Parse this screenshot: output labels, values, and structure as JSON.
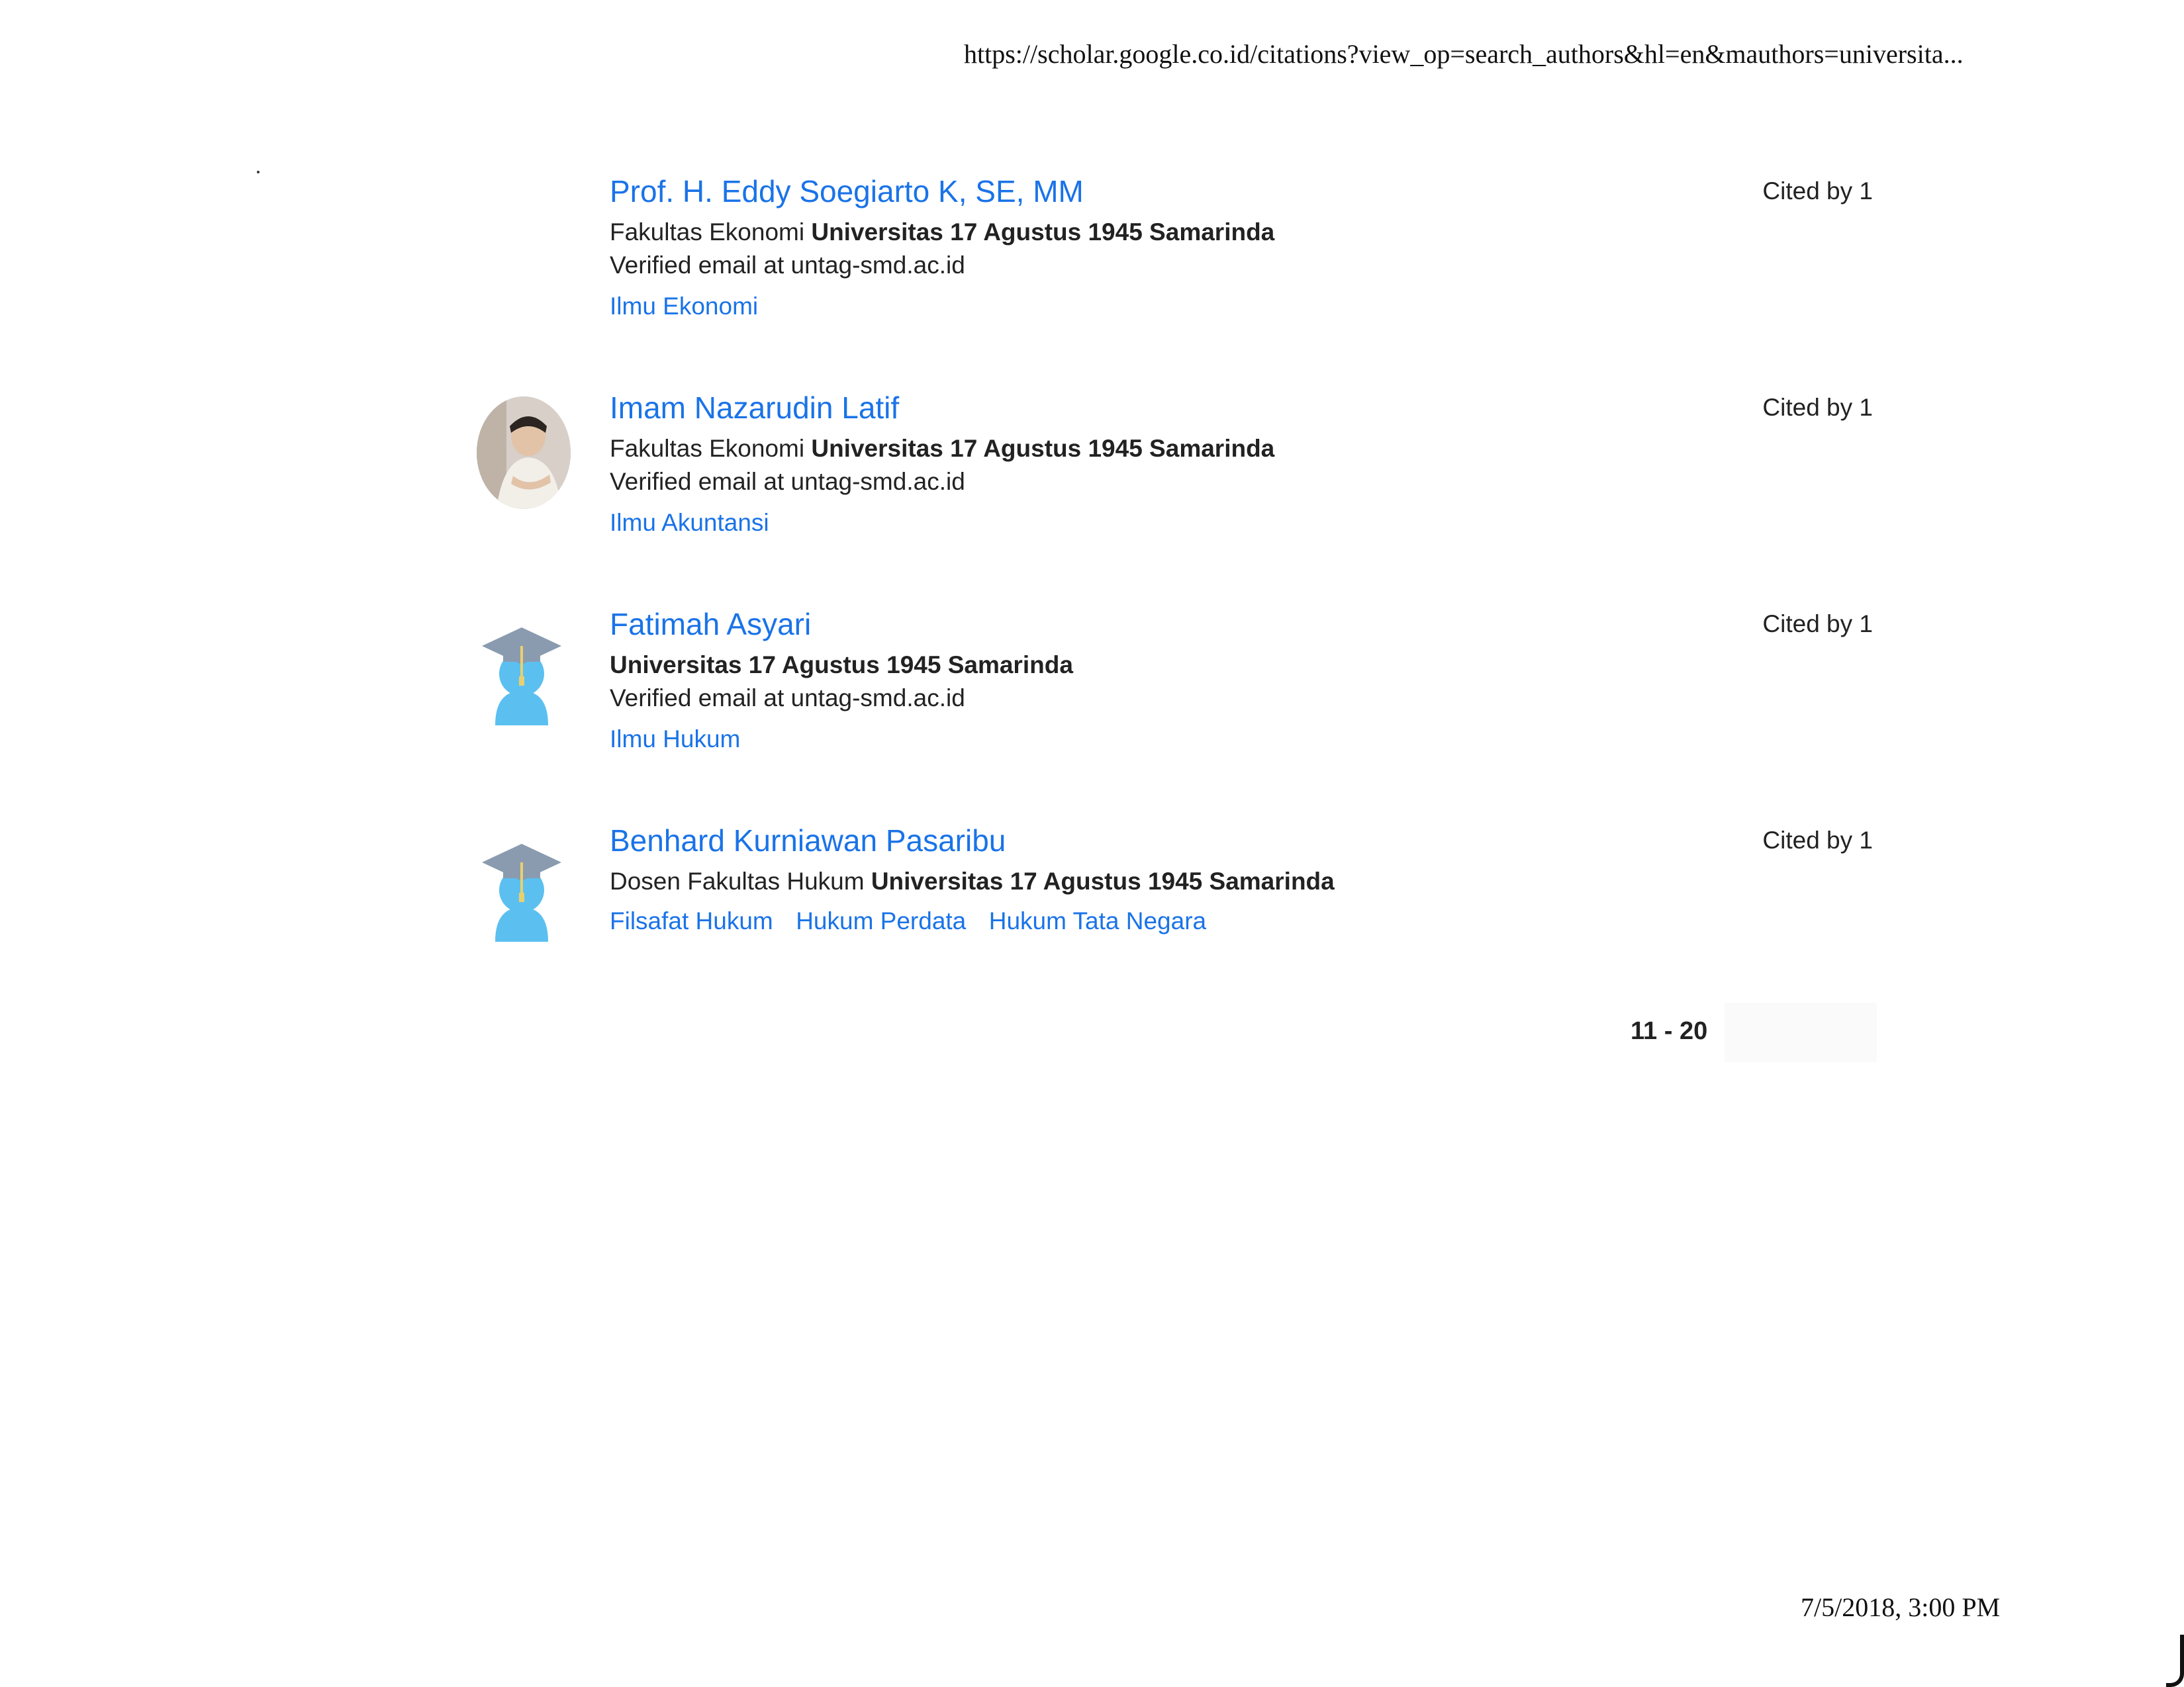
{
  "print": {
    "url": "https://scholar.google.co.id/citations?view_op=search_authors&hl=en&mauthors=universita...",
    "datetime": "7/5/2018, 3:00 PM"
  },
  "authors": [
    {
      "name": "Prof. H. Eddy Soegiarto K, SE, MM",
      "affiliation_prefix": "Fakultas Ekonomi",
      "affiliation_bold": "Universitas 17 Agustus 1945 Samarinda",
      "email": "Verified email at untag-smd.ac.id",
      "interests": [
        "Ilmu Ekonomi"
      ],
      "cited": "Cited by 1",
      "avatar": "none"
    },
    {
      "name": "Imam Nazarudin Latif",
      "affiliation_prefix": "Fakultas Ekonomi",
      "affiliation_bold": "Universitas 17 Agustus 1945 Samarinda",
      "email": "Verified email at untag-smd.ac.id",
      "interests": [
        "Ilmu Akuntansi"
      ],
      "cited": "Cited by 1",
      "avatar": "photo"
    },
    {
      "name": "Fatimah Asyari",
      "affiliation_prefix": "",
      "affiliation_bold": "Universitas 17 Agustus 1945 Samarinda",
      "email": "Verified email at untag-smd.ac.id",
      "interests": [
        "Ilmu Hukum"
      ],
      "cited": "Cited by 1",
      "avatar": "graduate-icon"
    },
    {
      "name": "Benhard Kurniawan Pasaribu",
      "affiliation_prefix": "Dosen Fakultas Hukum",
      "affiliation_bold": "Universitas 17 Agustus 1945 Samarinda",
      "email": "",
      "interests": [
        "Filsafat Hukum",
        "Hukum Perdata",
        "Hukum Tata Negara"
      ],
      "cited": "Cited by 1",
      "avatar": "graduate-icon"
    }
  ],
  "pagination": {
    "range": "11 - 20"
  },
  "colors": {
    "link": "#1a73e8",
    "text": "#222222",
    "avatar_body": "#5bc0f0",
    "cap": "#8a9bb0"
  }
}
